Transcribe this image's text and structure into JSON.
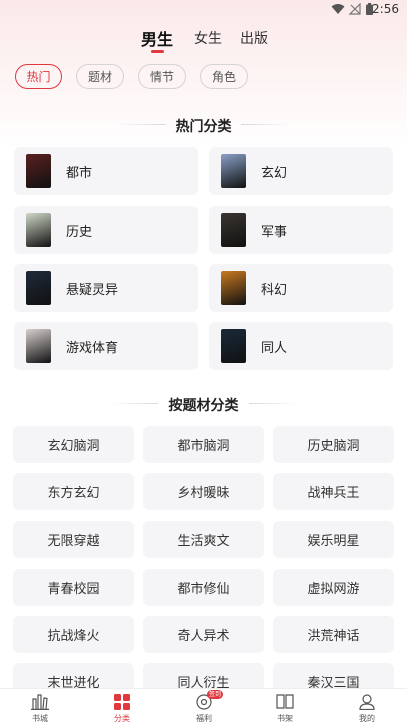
{
  "status_bar": {
    "time": "2:56"
  },
  "gender_tabs": [
    {
      "label": "男生",
      "active": true
    },
    {
      "label": "女生",
      "active": false
    },
    {
      "label": "出版",
      "active": false
    }
  ],
  "filters": [
    {
      "label": "热门",
      "active": true
    },
    {
      "label": "题材",
      "active": false
    },
    {
      "label": "情节",
      "active": false
    },
    {
      "label": "角色",
      "active": false
    }
  ],
  "hot_section": {
    "title": "热门分类",
    "items": [
      {
        "label": "都市",
        "cover_color": "#5a2020"
      },
      {
        "label": "玄幻",
        "cover_color": "#8aa0c8"
      },
      {
        "label": "历史",
        "cover_color": "#cfd8c8"
      },
      {
        "label": "军事",
        "cover_color": "#3a3530"
      },
      {
        "label": "悬疑灵异",
        "cover_color": "#1e2a3a"
      },
      {
        "label": "科幻",
        "cover_color": "#c87a20"
      },
      {
        "label": "游戏体育",
        "cover_color": "#d8d0d0"
      },
      {
        "label": "同人",
        "cover_color": "#1a2a3a"
      }
    ]
  },
  "subject_section": {
    "title": "按题材分类",
    "items": [
      "玄幻脑洞",
      "都市脑洞",
      "历史脑洞",
      "东方玄幻",
      "乡村暖昧",
      "战神兵王",
      "无限穿越",
      "生活爽文",
      "娱乐明星",
      "青春校园",
      "都市修仙",
      "虚拟网游",
      "抗战烽火",
      "奇人异术",
      "洪荒神话",
      "末世进化",
      "同人衍生",
      "秦汉三国"
    ]
  },
  "bottom_nav": [
    {
      "label": "书城",
      "icon": "bookstore-icon",
      "active": false
    },
    {
      "label": "分类",
      "icon": "category-grid-icon",
      "active": true
    },
    {
      "label": "福利",
      "icon": "welfare-icon",
      "active": false,
      "badge": "签到"
    },
    {
      "label": "书架",
      "icon": "bookshelf-icon",
      "active": false
    },
    {
      "label": "我的",
      "icon": "profile-icon",
      "active": false
    }
  ],
  "colors": {
    "accent": "#e0383e",
    "card_bg": "#f5f5f7"
  }
}
